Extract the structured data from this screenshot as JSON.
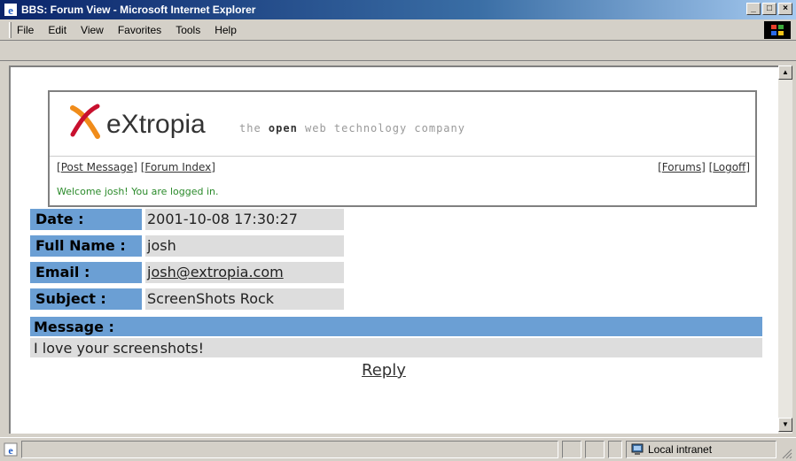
{
  "window": {
    "title": "BBS: Forum View - Microsoft Internet Explorer",
    "controls": [
      "_",
      "□",
      "×"
    ]
  },
  "menu": {
    "items": [
      {
        "label": "File",
        "key": "F"
      },
      {
        "label": "Edit",
        "key": "E"
      },
      {
        "label": "View",
        "key": "V"
      },
      {
        "label": "Favorites",
        "key": "a"
      },
      {
        "label": "Tools",
        "key": "T"
      },
      {
        "label": "Help",
        "key": "H"
      }
    ]
  },
  "header": {
    "brand": "eXtropia",
    "tagline_pre": "the ",
    "tagline_bold": "open",
    "tagline_post": " web technology company",
    "nav_left": [
      "Post Message",
      "Forum Index"
    ],
    "nav_right": [
      "Forums",
      "Logoff"
    ],
    "welcome": "Welcome josh! You are logged in."
  },
  "post": {
    "fields": [
      {
        "label": "Date :",
        "value": "2001-10-08 17:30:27"
      },
      {
        "label": "Full Name :",
        "value": "josh"
      },
      {
        "label": "Email :",
        "value": "josh@extropia.com"
      },
      {
        "label": "Subject :",
        "value": "ScreenShots Rock"
      }
    ],
    "message_label": "Message :",
    "message_body": "I love your screenshots!",
    "reply_label": "Reply"
  },
  "status": {
    "zone": "Local intranet"
  },
  "colors": {
    "label_bg": "#6b9fd4",
    "value_bg": "#dddddd",
    "welcome_text": "#2a8a2a",
    "logo_orange": "#f08c1a",
    "logo_red": "#c8102e"
  }
}
